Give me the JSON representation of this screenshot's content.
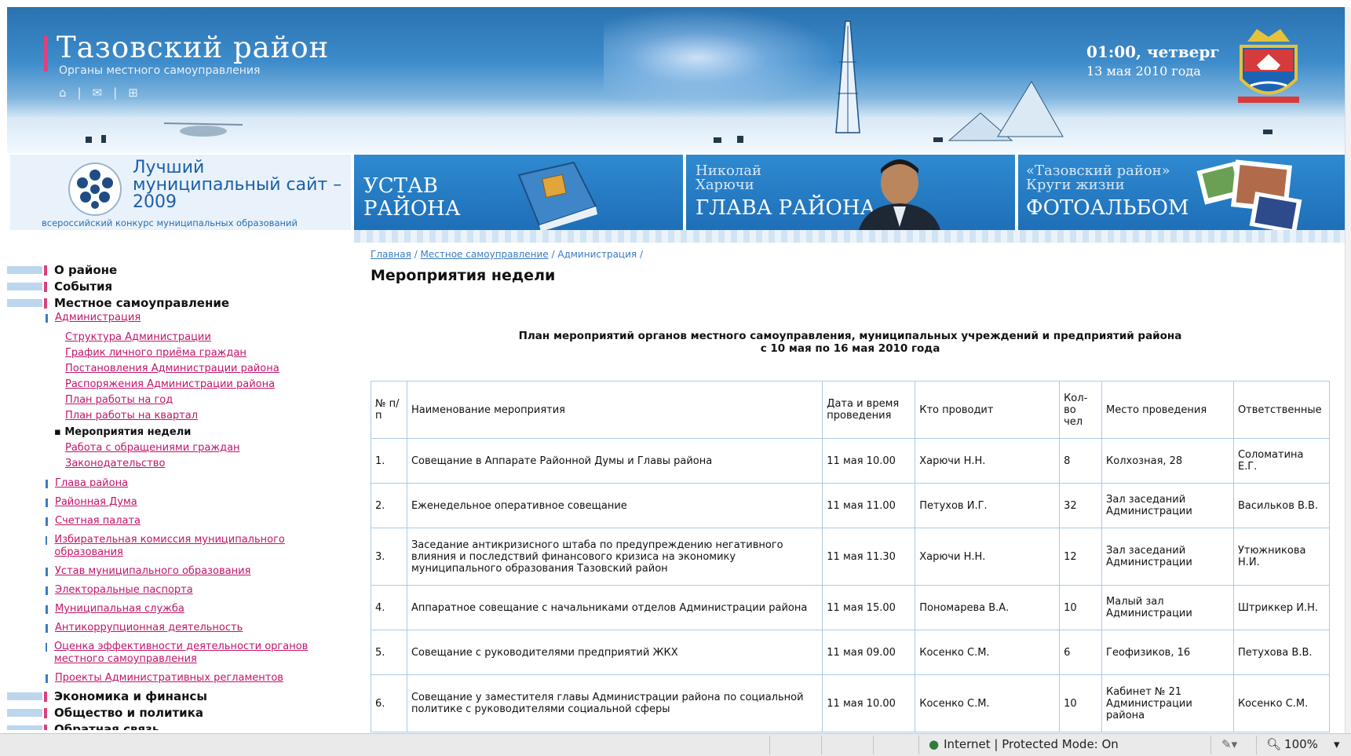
{
  "header": {
    "site_title": "Тазовский район",
    "site_subtitle": "Органы местного самоуправления",
    "time": "01:00, четверг",
    "date": "13 мая 2010 года",
    "icons": [
      "home-icon",
      "mail-icon",
      "sitemap-icon"
    ]
  },
  "banners": {
    "contest_title": "Лучший муниципальный сайт – 2009",
    "contest_note": "всероссийский конкурс муниципальных образований",
    "charter": "УСТАВ РАЙОНА",
    "head_name": "Николай Харючи",
    "head_title": "ГЛАВА РАЙОНА",
    "album_subtitle": "«Тазовский район» Круги жизни",
    "album_title": "ФОТОАЛЬБОМ"
  },
  "sidebar": {
    "top": [
      "О районе",
      "События",
      "Местное самоуправление"
    ],
    "admin": "Администрация",
    "admin_children": [
      "Структура Администрации",
      "График личного приёма граждан",
      "Постановления Администрации района",
      "Распоряжения Администрации района",
      "План работы на год",
      "План работы на квартал"
    ],
    "current": "Мероприятия недели",
    "admin_children_after": [
      "Работа с обращениями граждан",
      "Законодательство"
    ],
    "links": [
      "Глава района",
      "Районная Дума",
      "Счетная палата",
      "Избирательная комиссия муниципального образования",
      "Устав муниципального образования",
      "Электоральные паспорта",
      "Муниципальная служба",
      "Антикоррупционная деятельность",
      "Оценка эффективности деятельности органов местного самоуправления",
      "Проекты Административных регламентов"
    ],
    "bottom": [
      "Экономика и финансы",
      "Общество и политика",
      "Обратная связь"
    ]
  },
  "breadcrumb": {
    "home": "Главная",
    "section": "Местное самоуправление",
    "current": "Администрация",
    "sep": "/"
  },
  "main": {
    "title": "Мероприятия недели",
    "plan_line1": "План мероприятий органов местного самоуправления, муниципальных учреждений и предприятий района",
    "plan_line2": "с 10 мая по 16 мая 2010 года"
  },
  "table": {
    "headers": [
      "№ п/п",
      "Наименование мероприятия",
      "Дата и время проведения",
      "Кто проводит",
      "Кол-во чел",
      "Место проведения",
      "Ответственные"
    ],
    "rows": [
      [
        "1.",
        "Совещание в Аппарате Районной Думы и Главы района",
        "11 мая 10.00",
        "Харючи Н.Н.",
        "8",
        "Колхозная, 28",
        "Соломатина Е.Г."
      ],
      [
        "2.",
        "Еженедельное оперативное совещание",
        "11 мая 11.00",
        "Петухов И.Г.",
        "32",
        "Зал заседаний Администрации",
        "Васильков В.В."
      ],
      [
        "3.",
        "Заседание антикризисного штаба по предупреждению негативного влияния и последствий финансового кризиса на экономику муниципального образования Тазовский район",
        "11 мая 11.30",
        "Харючи Н.Н.",
        "12",
        "Зал заседаний Администрации",
        "Утюжникова Н.И."
      ],
      [
        "4.",
        "Аппаратное совещание с начальниками отделов Администрации района",
        "11 мая 15.00",
        "Пономарева В.А.",
        "10",
        "Малый зал Администрации",
        "Штриккер И.Н."
      ],
      [
        "5.",
        "Совещание с руководителями предприятий ЖКХ",
        "11 мая 09.00",
        "Косенко С.М.",
        "6",
        "Геофизиков, 16",
        "Петухова В.В."
      ],
      [
        "6.",
        "Совещание у заместителя главы Администрации района по социальной политике с руководителями социальной сферы",
        "11 мая 10.00",
        "Косенко С.М.",
        "10",
        "Кабинет № 21 Администрации района",
        "Косенко С.М."
      ]
    ]
  },
  "statusbar": {
    "zone": "Internet | Protected Mode: On",
    "zoom": "100%"
  },
  "colors": {
    "accent": "#c0166b",
    "header_blue": "#2a72b0",
    "table_border": "#a9cbe8",
    "menu_mark": "#d9427e"
  }
}
